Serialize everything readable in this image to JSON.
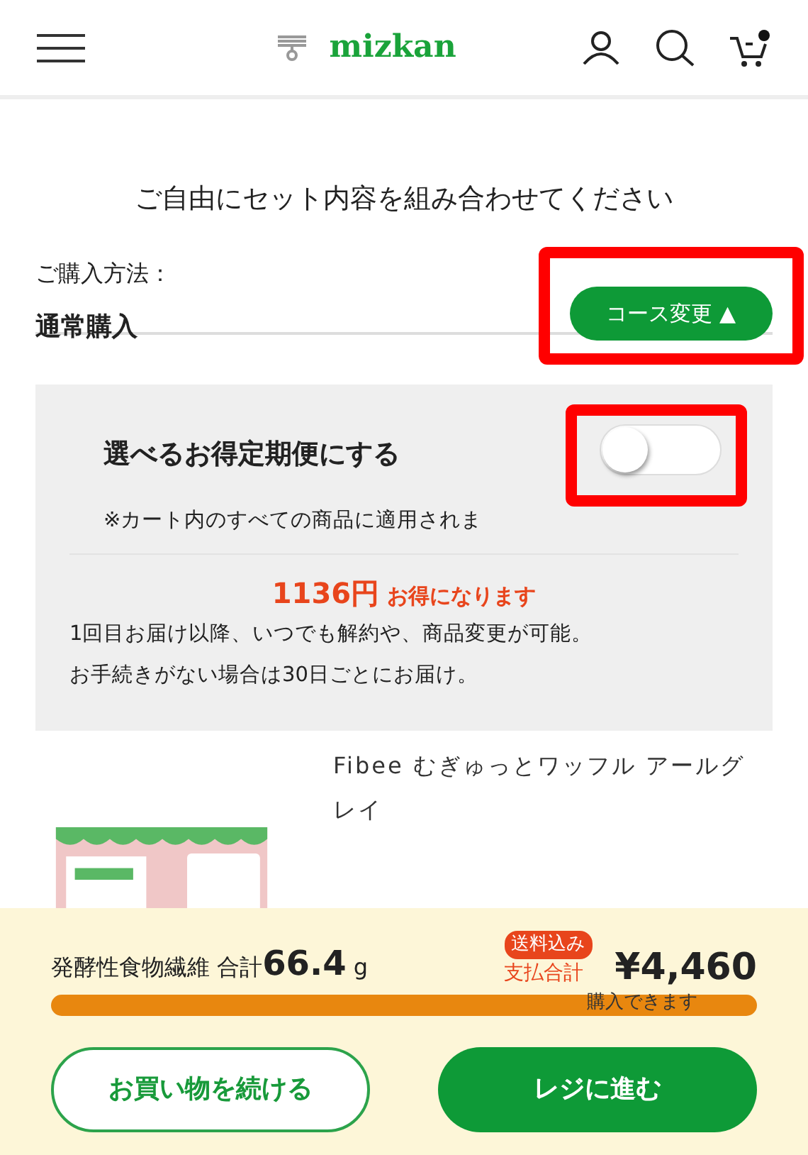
{
  "header": {
    "logo": "mizkan",
    "cart_badge": true
  },
  "headline": "ご自由にセット内容を組み合わせてください",
  "purchase": {
    "label": "ご購入方法：",
    "method": "通常購入",
    "change_button": "コース変更 ▲"
  },
  "subscription": {
    "title": "選べるお得定期便にする",
    "on": false,
    "note": "※カート内のすべての商品に適用されま",
    "saving_amount": "1136円",
    "saving_text": "お得になります",
    "lines": [
      "1回目お届け以降、いつでも解約や、商品変更が可能。",
      "お手続きがない場合は30日ごとにお届け。"
    ]
  },
  "product": {
    "title": "Fibee むぎゅっとワッフル アールグレイ"
  },
  "footer": {
    "fiber_label": "発酵性食物繊維 合計",
    "fiber_value": "66.4",
    "fiber_unit": "g",
    "shipping_badge": "送料込み",
    "total_label": "支払合計",
    "total": "¥4,460",
    "level": 1,
    "status": "購入できます",
    "buttons": [
      {
        "kind": "secondary",
        "label": "お買い物を続ける"
      },
      {
        "kind": "primary",
        "label": "レジに進む"
      }
    ]
  }
}
